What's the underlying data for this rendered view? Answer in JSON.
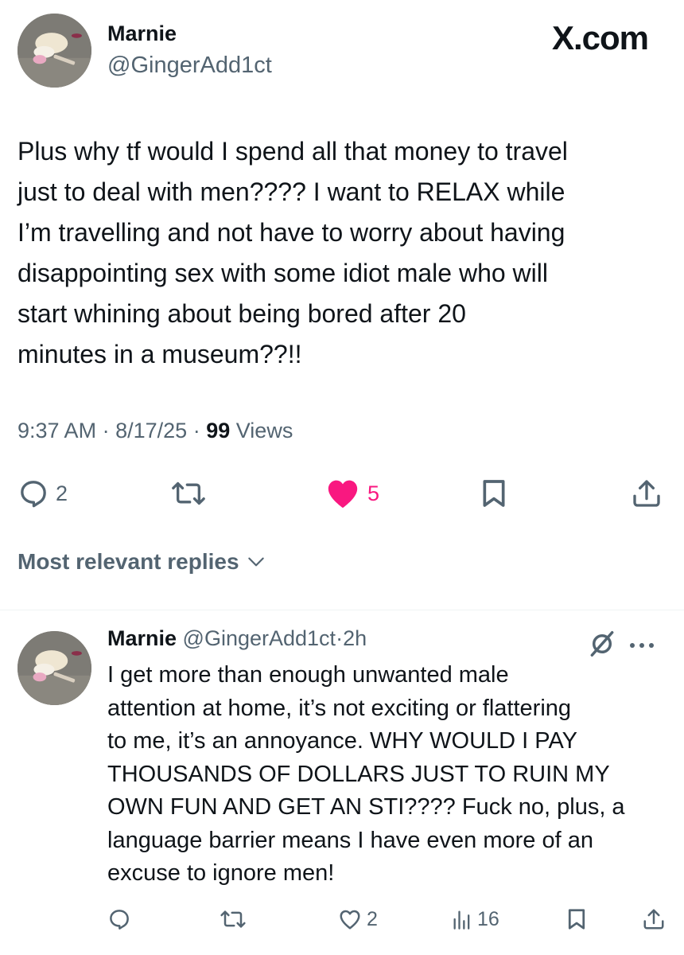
{
  "brand": {
    "label": "X.com"
  },
  "tweet": {
    "author_name": "Marnie",
    "author_handle": "@GingerAdd1ct",
    "text_lines": [
      "Plus why tf would I spend all that money to travel",
      "just to deal with men???? I want to RELAX while",
      "I’m travelling and not have to worry about having",
      "disappointing sex with some idiot male who will",
      "start whining about being bored after 20",
      "minutes in  a museum??!!"
    ],
    "time": "9:37 AM",
    "separator": "·",
    "date": "8/17/25",
    "views_count": "99",
    "views_label": "Views",
    "actions": {
      "reply_icon": "reply-bubble-icon",
      "reply_count": "2",
      "retweet_icon": "retweet-icon",
      "like_icon": "heart-filled-icon",
      "like_count": "5",
      "bookmark_icon": "bookmark-icon",
      "share_icon": "share-icon"
    },
    "colors": {
      "like": "#f91880",
      "muted": "#536471",
      "text": "#0f1419"
    }
  },
  "replies_sort": {
    "label": "Most relevant replies",
    "icon": "chevron-down-icon"
  },
  "reply": {
    "author_name": "Marnie",
    "author_handle": "@GingerAdd1ct",
    "separator": "·",
    "time": "2h",
    "grok_icon": "grok-slash-icon",
    "more_icon": "more-dots-icon",
    "text_lines": [
      "I get more than enough unwanted male",
      "attention at home, it’s not exciting or flattering",
      "to me, it’s an annoyance. WHY WOULD I PAY",
      "THOUSANDS OF DOLLARS JUST TO RUIN MY",
      "OWN FUN AND GET AN STI???? Fuck no, plus, a",
      "language barrier means I have even more of an",
      "excuse to ignore men!"
    ],
    "actions": {
      "reply_count": "",
      "retweet_count": "",
      "like_count": "2",
      "views_count": "16"
    }
  }
}
